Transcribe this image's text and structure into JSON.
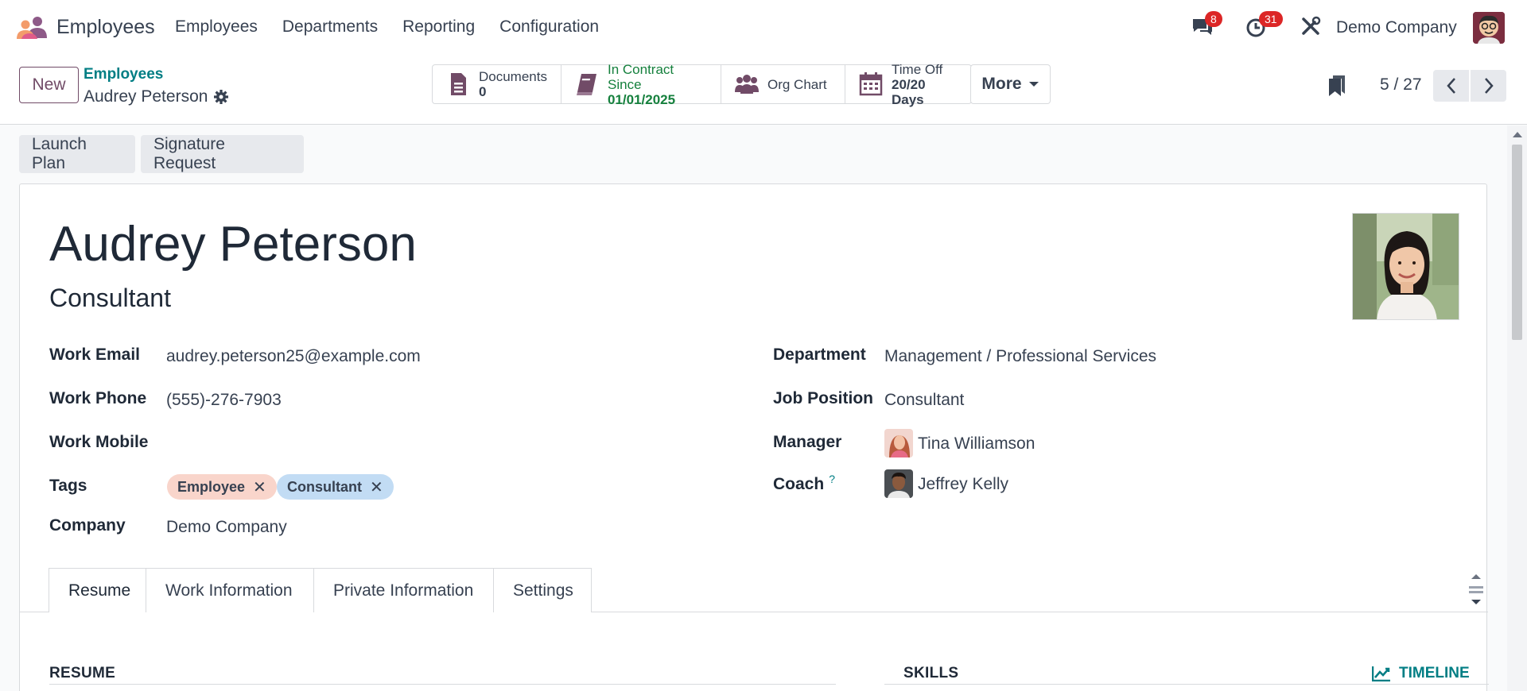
{
  "navbar": {
    "app_name": "Employees",
    "menu": [
      "Employees",
      "Departments",
      "Reporting",
      "Configuration"
    ],
    "messages_count": "8",
    "activities_count": "31",
    "company": "Demo Company"
  },
  "control_panel": {
    "new_label": "New",
    "breadcrumb_parent": "Employees",
    "breadcrumb_current": "Audrey Peterson",
    "smart_buttons": {
      "documents_label": "Documents",
      "documents_value": "0",
      "contract_label": "In Contract Since",
      "contract_value": "01/01/2025",
      "org_chart_label": "Org Chart",
      "time_off_label": "Time Off",
      "time_off_value": "20/20 Days"
    },
    "more_label": "More",
    "pager": "5 / 27"
  },
  "actions": {
    "launch_plan": "Launch Plan",
    "signature_request": "Signature Request"
  },
  "employee": {
    "name": "Audrey Peterson",
    "job_title": "Consultant",
    "labels": {
      "work_email": "Work Email",
      "work_phone": "Work Phone",
      "work_mobile": "Work Mobile",
      "tags": "Tags",
      "company": "Company",
      "department": "Department",
      "job_position": "Job Position",
      "manager": "Manager",
      "coach": "Coach",
      "coach_help": "?"
    },
    "work_email": "audrey.peterson25@example.com",
    "work_phone": "(555)-276-7903",
    "work_mobile": "",
    "tags": [
      "Employee",
      "Consultant"
    ],
    "company": "Demo Company",
    "department": "Management / Professional Services",
    "job_position": "Consultant",
    "manager": "Tina Williamson",
    "coach": "Jeffrey Kelly"
  },
  "tabs": [
    "Resume",
    "Work Information",
    "Private Information",
    "Settings"
  ],
  "sections": {
    "resume": "RESUME",
    "skills": "SKILLS",
    "timeline": "TIMELINE"
  },
  "colors": {
    "brand": "#714b67",
    "link": "#017e84",
    "success": "#15803d",
    "badge": "#dc2626"
  }
}
